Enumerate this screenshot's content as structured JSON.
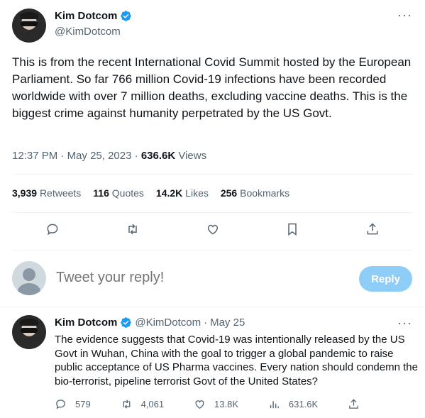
{
  "tweet": {
    "author_name": "Kim Dotcom",
    "author_handle": "@KimDotcom",
    "text": "This is from the recent International Covid Summit hosted by the European Parliament. So far 766 million Covid-19 infections have been recorded worldwide with over 7 million deaths, excluding vaccine deaths. This is the biggest crime against humanity perpetrated by the US Govt.",
    "time": "12:37 PM",
    "separator": " · ",
    "date": "May 25, 2023",
    "views_count": "636.6K",
    "views_label": "Views",
    "more_label": "···"
  },
  "stats": {
    "retweets_count": "3,939",
    "retweets_label": "Retweets",
    "quotes_count": "116",
    "quotes_label": "Quotes",
    "likes_count": "14.2K",
    "likes_label": "Likes",
    "bookmarks_count": "256",
    "bookmarks_label": "Bookmarks"
  },
  "actions": {
    "icons": [
      "reply-icon",
      "retweet-icon",
      "like-icon",
      "bookmark-icon",
      "share-icon"
    ]
  },
  "reply_box": {
    "placeholder": "Tweet your reply!",
    "button_label": "Reply"
  },
  "reply_tweet": {
    "author_name": "Kim Dotcom",
    "author_handle": "@KimDotcom",
    "separator": "·",
    "date": "May 25",
    "more_label": "···",
    "text": "The evidence suggests that Covid-19 was intentionally released by the US Govt in Wuhan, China with the goal to trigger a global pandemic to raise public acceptance of US Pharma vaccines. Every nation should condemn the bio-terrorist, pipeline terrorist Govt of the United States?",
    "replies": "579",
    "retweets": "4,061",
    "likes": "13.8K",
    "views": "631.6K"
  },
  "colors": {
    "accent": "#1d9bf0",
    "accent_disabled": "#8ecdf8",
    "secondary_text": "#536471",
    "primary_text": "#0f1419",
    "border": "#eff3f4"
  }
}
